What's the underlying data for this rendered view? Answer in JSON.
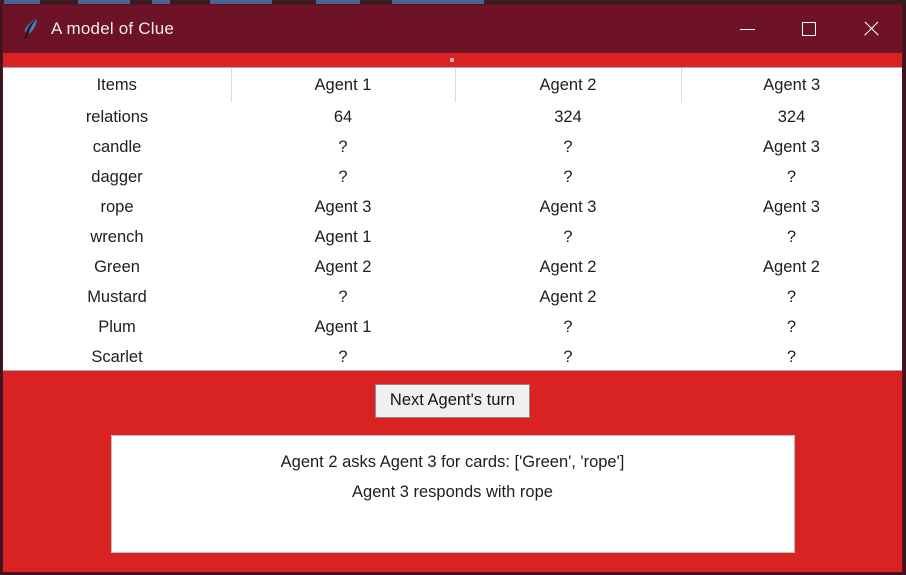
{
  "window": {
    "title": "A model of Clue",
    "icon": "feather-quill-icon",
    "minimize_label": "Minimize",
    "maximize_label": "Maximize",
    "close_label": "Close",
    "title_bar_color": "#6e1228",
    "body_color": "#d92322"
  },
  "table": {
    "columns": [
      "Items",
      "Agent 1",
      "Agent 2",
      "Agent 3"
    ],
    "rows": [
      {
        "item": "relations",
        "agent1": "64",
        "agent2": "324",
        "agent3": "324"
      },
      {
        "item": "candle",
        "agent1": "?",
        "agent2": "?",
        "agent3": "Agent 3"
      },
      {
        "item": "dagger",
        "agent1": "?",
        "agent2": "?",
        "agent3": "?"
      },
      {
        "item": "rope",
        "agent1": "Agent 3",
        "agent2": "Agent 3",
        "agent3": "Agent 3"
      },
      {
        "item": "wrench",
        "agent1": "Agent 1",
        "agent2": "?",
        "agent3": "?"
      },
      {
        "item": "Green",
        "agent1": "Agent 2",
        "agent2": "Agent 2",
        "agent3": "Agent 2"
      },
      {
        "item": "Mustard",
        "agent1": "?",
        "agent2": "Agent 2",
        "agent3": "?"
      },
      {
        "item": "Plum",
        "agent1": "Agent 1",
        "agent2": "?",
        "agent3": "?"
      },
      {
        "item": "Scarlet",
        "agent1": "?",
        "agent2": "?",
        "agent3": "?"
      }
    ]
  },
  "controls": {
    "next_turn_label": "Next Agent's turn"
  },
  "log": {
    "lines": [
      "Agent 2 asks Agent 3 for cards: ['Green', 'rope']",
      "Agent 3 responds with rope"
    ]
  }
}
